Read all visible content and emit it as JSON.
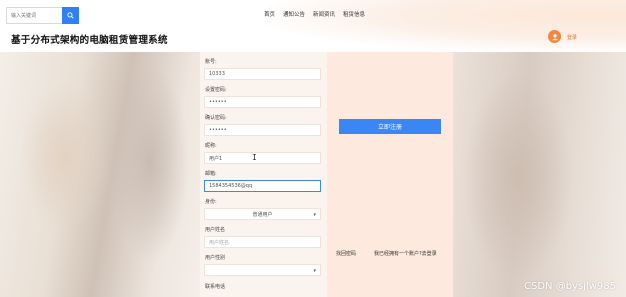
{
  "header": {
    "search": {
      "placeholder": "输入关键词"
    },
    "nav": [
      "首页",
      "通知公告",
      "新闻资讯",
      "租赁信息"
    ],
    "site_title": "基于分布式架构的电脑租赁管理系统",
    "login_label": "登录"
  },
  "form": {
    "account": {
      "label": "账号:",
      "value": "10333"
    },
    "password": {
      "label": "设置密码:",
      "value": "••••••"
    },
    "confirm_password": {
      "label": "确认密码:",
      "value": "••••••"
    },
    "nickname": {
      "label": "昵称:",
      "value": "用户1"
    },
    "email": {
      "label": "邮箱:",
      "value": "1584354536@qq"
    },
    "identity": {
      "label": "身份:",
      "value": "普通用户"
    },
    "username": {
      "label": "用户姓名",
      "placeholder": "用户姓名"
    },
    "gender": {
      "label": "用户性别",
      "value": ""
    },
    "phone": {
      "label": "联系电话"
    }
  },
  "actions": {
    "register_label": "立即注册",
    "forgot_label": "找回密码",
    "have_account_label": "我已经拥有一个账户?去登录"
  },
  "watermark": "CSDN @bysjlw985",
  "colors": {
    "accent": "#3b86f5",
    "avatar": "#f5863a",
    "panel": "#fbf3ee",
    "side": "#fde9dd"
  }
}
